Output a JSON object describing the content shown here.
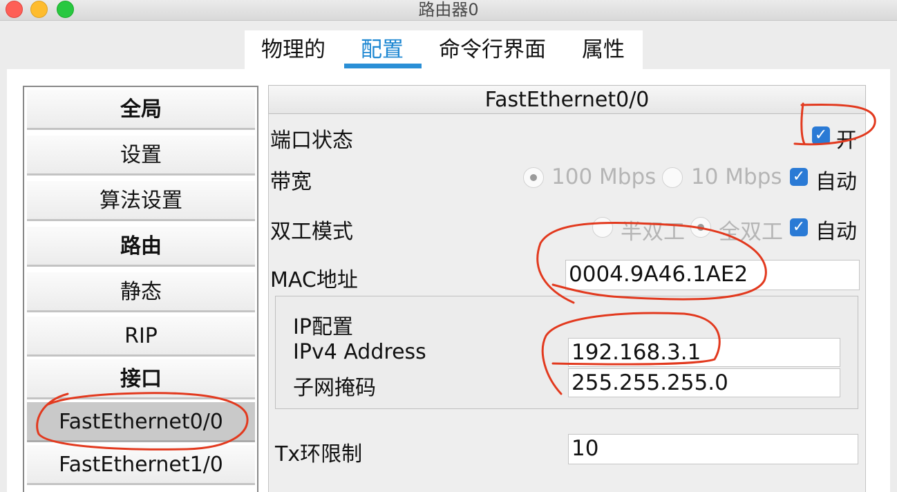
{
  "window": {
    "title": "路由器0"
  },
  "tabs": [
    {
      "label": "物理的"
    },
    {
      "label": "配置",
      "active": true
    },
    {
      "label": "命令行界面"
    },
    {
      "label": "属性"
    }
  ],
  "nav": {
    "items": [
      {
        "label": "全局",
        "style": "bold"
      },
      {
        "label": "设置"
      },
      {
        "label": "算法设置"
      },
      {
        "label": "路由",
        "style": "bold"
      },
      {
        "label": "静态"
      },
      {
        "label": "RIP"
      },
      {
        "label": "接口",
        "style": "bold"
      },
      {
        "label": "FastEthernet0/0",
        "selected": true
      },
      {
        "label": "FastEthernet1/0"
      }
    ]
  },
  "interface": {
    "header": "FastEthernet0/0",
    "port_status": {
      "label": "端口状态",
      "checkbox_label": "开",
      "checked": true
    },
    "bandwidth": {
      "label": "带宽",
      "options": [
        "100 Mbps",
        "10 Mbps"
      ],
      "selected": "100 Mbps",
      "auto_label": "自动",
      "auto_checked": true
    },
    "duplex": {
      "label": "双工模式",
      "options": [
        "半双工",
        "全双工"
      ],
      "selected": "全双工",
      "auto_label": "自动",
      "auto_checked": true
    },
    "mac": {
      "label": "MAC地址",
      "value": "0004.9A46.1AE2"
    },
    "ip_config": {
      "title": "IP配置",
      "ipv4_label": "IPv4 Address",
      "ipv4_value": "192.168.3.1",
      "mask_label": "子网掩码",
      "mask_value": "255.255.255.0"
    },
    "tx_ring": {
      "label": "Tx环限制",
      "value": "10"
    }
  },
  "colors": {
    "tab_active": "#1d87d2",
    "checkbox": "#2a7ad5",
    "annotation": "#e2391e"
  }
}
